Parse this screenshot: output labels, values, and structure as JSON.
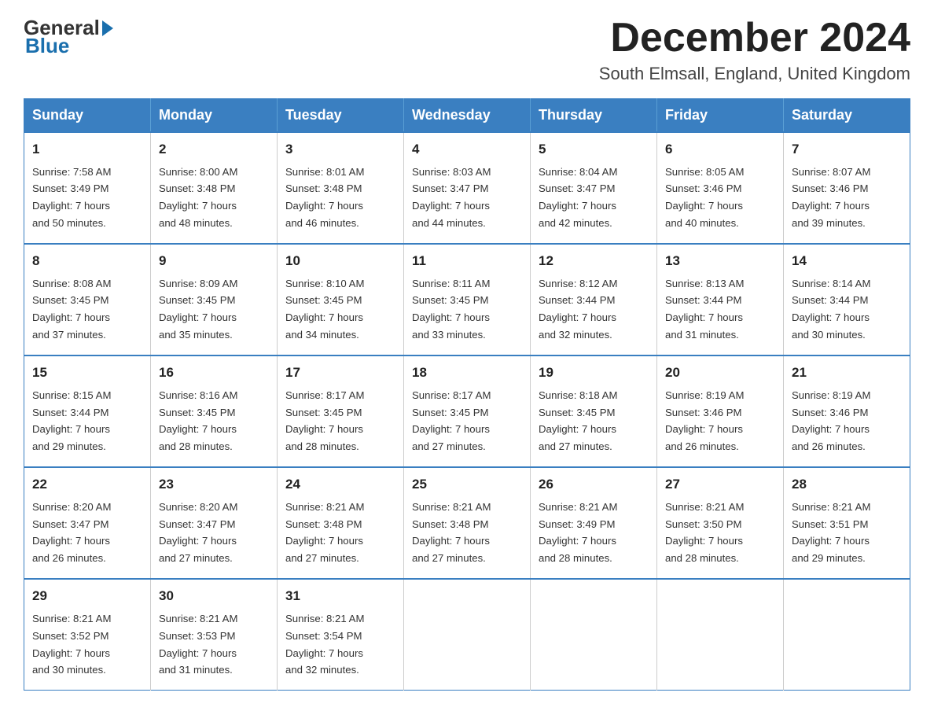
{
  "logo": {
    "general": "General",
    "blue": "Blue"
  },
  "title": "December 2024",
  "location": "South Elmsall, England, United Kingdom",
  "days_of_week": [
    "Sunday",
    "Monday",
    "Tuesday",
    "Wednesday",
    "Thursday",
    "Friday",
    "Saturday"
  ],
  "weeks": [
    [
      {
        "day": "1",
        "sunrise": "7:58 AM",
        "sunset": "3:49 PM",
        "daylight": "7 hours and 50 minutes."
      },
      {
        "day": "2",
        "sunrise": "8:00 AM",
        "sunset": "3:48 PM",
        "daylight": "7 hours and 48 minutes."
      },
      {
        "day": "3",
        "sunrise": "8:01 AM",
        "sunset": "3:48 PM",
        "daylight": "7 hours and 46 minutes."
      },
      {
        "day": "4",
        "sunrise": "8:03 AM",
        "sunset": "3:47 PM",
        "daylight": "7 hours and 44 minutes."
      },
      {
        "day": "5",
        "sunrise": "8:04 AM",
        "sunset": "3:47 PM",
        "daylight": "7 hours and 42 minutes."
      },
      {
        "day": "6",
        "sunrise": "8:05 AM",
        "sunset": "3:46 PM",
        "daylight": "7 hours and 40 minutes."
      },
      {
        "day": "7",
        "sunrise": "8:07 AM",
        "sunset": "3:46 PM",
        "daylight": "7 hours and 39 minutes."
      }
    ],
    [
      {
        "day": "8",
        "sunrise": "8:08 AM",
        "sunset": "3:45 PM",
        "daylight": "7 hours and 37 minutes."
      },
      {
        "day": "9",
        "sunrise": "8:09 AM",
        "sunset": "3:45 PM",
        "daylight": "7 hours and 35 minutes."
      },
      {
        "day": "10",
        "sunrise": "8:10 AM",
        "sunset": "3:45 PM",
        "daylight": "7 hours and 34 minutes."
      },
      {
        "day": "11",
        "sunrise": "8:11 AM",
        "sunset": "3:45 PM",
        "daylight": "7 hours and 33 minutes."
      },
      {
        "day": "12",
        "sunrise": "8:12 AM",
        "sunset": "3:44 PM",
        "daylight": "7 hours and 32 minutes."
      },
      {
        "day": "13",
        "sunrise": "8:13 AM",
        "sunset": "3:44 PM",
        "daylight": "7 hours and 31 minutes."
      },
      {
        "day": "14",
        "sunrise": "8:14 AM",
        "sunset": "3:44 PM",
        "daylight": "7 hours and 30 minutes."
      }
    ],
    [
      {
        "day": "15",
        "sunrise": "8:15 AM",
        "sunset": "3:44 PM",
        "daylight": "7 hours and 29 minutes."
      },
      {
        "day": "16",
        "sunrise": "8:16 AM",
        "sunset": "3:45 PM",
        "daylight": "7 hours and 28 minutes."
      },
      {
        "day": "17",
        "sunrise": "8:17 AM",
        "sunset": "3:45 PM",
        "daylight": "7 hours and 28 minutes."
      },
      {
        "day": "18",
        "sunrise": "8:17 AM",
        "sunset": "3:45 PM",
        "daylight": "7 hours and 27 minutes."
      },
      {
        "day": "19",
        "sunrise": "8:18 AM",
        "sunset": "3:45 PM",
        "daylight": "7 hours and 27 minutes."
      },
      {
        "day": "20",
        "sunrise": "8:19 AM",
        "sunset": "3:46 PM",
        "daylight": "7 hours and 26 minutes."
      },
      {
        "day": "21",
        "sunrise": "8:19 AM",
        "sunset": "3:46 PM",
        "daylight": "7 hours and 26 minutes."
      }
    ],
    [
      {
        "day": "22",
        "sunrise": "8:20 AM",
        "sunset": "3:47 PM",
        "daylight": "7 hours and 26 minutes."
      },
      {
        "day": "23",
        "sunrise": "8:20 AM",
        "sunset": "3:47 PM",
        "daylight": "7 hours and 27 minutes."
      },
      {
        "day": "24",
        "sunrise": "8:21 AM",
        "sunset": "3:48 PM",
        "daylight": "7 hours and 27 minutes."
      },
      {
        "day": "25",
        "sunrise": "8:21 AM",
        "sunset": "3:48 PM",
        "daylight": "7 hours and 27 minutes."
      },
      {
        "day": "26",
        "sunrise": "8:21 AM",
        "sunset": "3:49 PM",
        "daylight": "7 hours and 28 minutes."
      },
      {
        "day": "27",
        "sunrise": "8:21 AM",
        "sunset": "3:50 PM",
        "daylight": "7 hours and 28 minutes."
      },
      {
        "day": "28",
        "sunrise": "8:21 AM",
        "sunset": "3:51 PM",
        "daylight": "7 hours and 29 minutes."
      }
    ],
    [
      {
        "day": "29",
        "sunrise": "8:21 AM",
        "sunset": "3:52 PM",
        "daylight": "7 hours and 30 minutes."
      },
      {
        "day": "30",
        "sunrise": "8:21 AM",
        "sunset": "3:53 PM",
        "daylight": "7 hours and 31 minutes."
      },
      {
        "day": "31",
        "sunrise": "8:21 AM",
        "sunset": "3:54 PM",
        "daylight": "7 hours and 32 minutes."
      },
      null,
      null,
      null,
      null
    ]
  ],
  "labels": {
    "sunrise": "Sunrise:",
    "sunset": "Sunset:",
    "daylight": "Daylight:"
  }
}
